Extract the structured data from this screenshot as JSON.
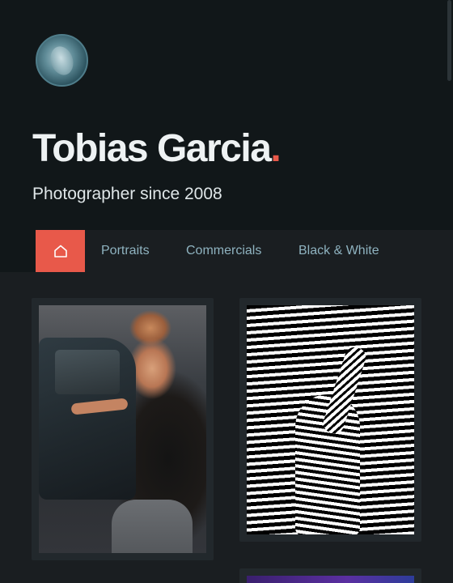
{
  "profile": {
    "name": "Tobias Garcia",
    "name_dot": ".",
    "tagline": "Photographer since 2008",
    "avatar_icon": "portrait-avatar"
  },
  "nav": {
    "home_icon": "home-icon",
    "tabs": [
      {
        "label": "Portraits"
      },
      {
        "label": "Commercials"
      },
      {
        "label": "Black & White"
      }
    ],
    "active": "home"
  },
  "gallery": {
    "items": [
      {
        "subject": "woman-by-car-photo"
      },
      {
        "subject": "black-and-white-wave-photo"
      },
      {
        "subject": "purple-photo"
      }
    ]
  },
  "colors": {
    "accent": "#e8594a",
    "hero_bg": "#111719",
    "page_bg": "#1a1e21",
    "card_bg": "#22282c",
    "tab_text": "#8fb3c0"
  }
}
